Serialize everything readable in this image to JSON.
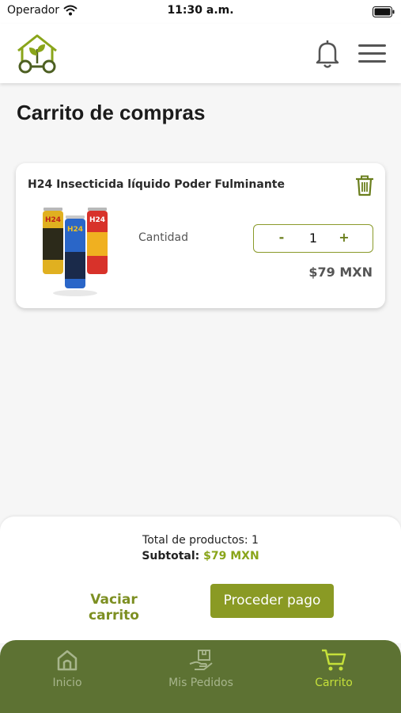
{
  "status_bar": {
    "carrier": "Operador",
    "time": "11:30 a.m."
  },
  "header": {
    "logo_icon": "house-leaf-logo-icon",
    "bell_icon": "bell-icon",
    "menu_icon": "hamburger-menu-icon"
  },
  "page": {
    "title": "Carrito de compras"
  },
  "cart": {
    "items": [
      {
        "name": "H24 Insecticida líquido Poder Fulminante",
        "quantity_label": "Cantidad",
        "quantity": "1",
        "minus": "-",
        "plus": "+",
        "price": "$79 MXN",
        "image": "product-spray-cans"
      }
    ]
  },
  "summary": {
    "total_products": "Total de productos: 1",
    "subtotal_label": "Subtotal:",
    "subtotal_value": "$79 MXN",
    "empty_cart": "Vaciar carrito",
    "checkout": "Proceder pago"
  },
  "nav": {
    "items": [
      {
        "label": "Inicio",
        "icon": "home-icon",
        "active": false
      },
      {
        "label": "Mis Pedidos",
        "icon": "package-hand-icon",
        "active": false
      },
      {
        "label": "Carrito",
        "icon": "cart-icon",
        "active": true
      }
    ]
  },
  "colors": {
    "accent": "#8a9a24",
    "nav_bg": "#5d7233",
    "nav_active": "#c5e03a",
    "price_highlight": "#8aa51a"
  }
}
